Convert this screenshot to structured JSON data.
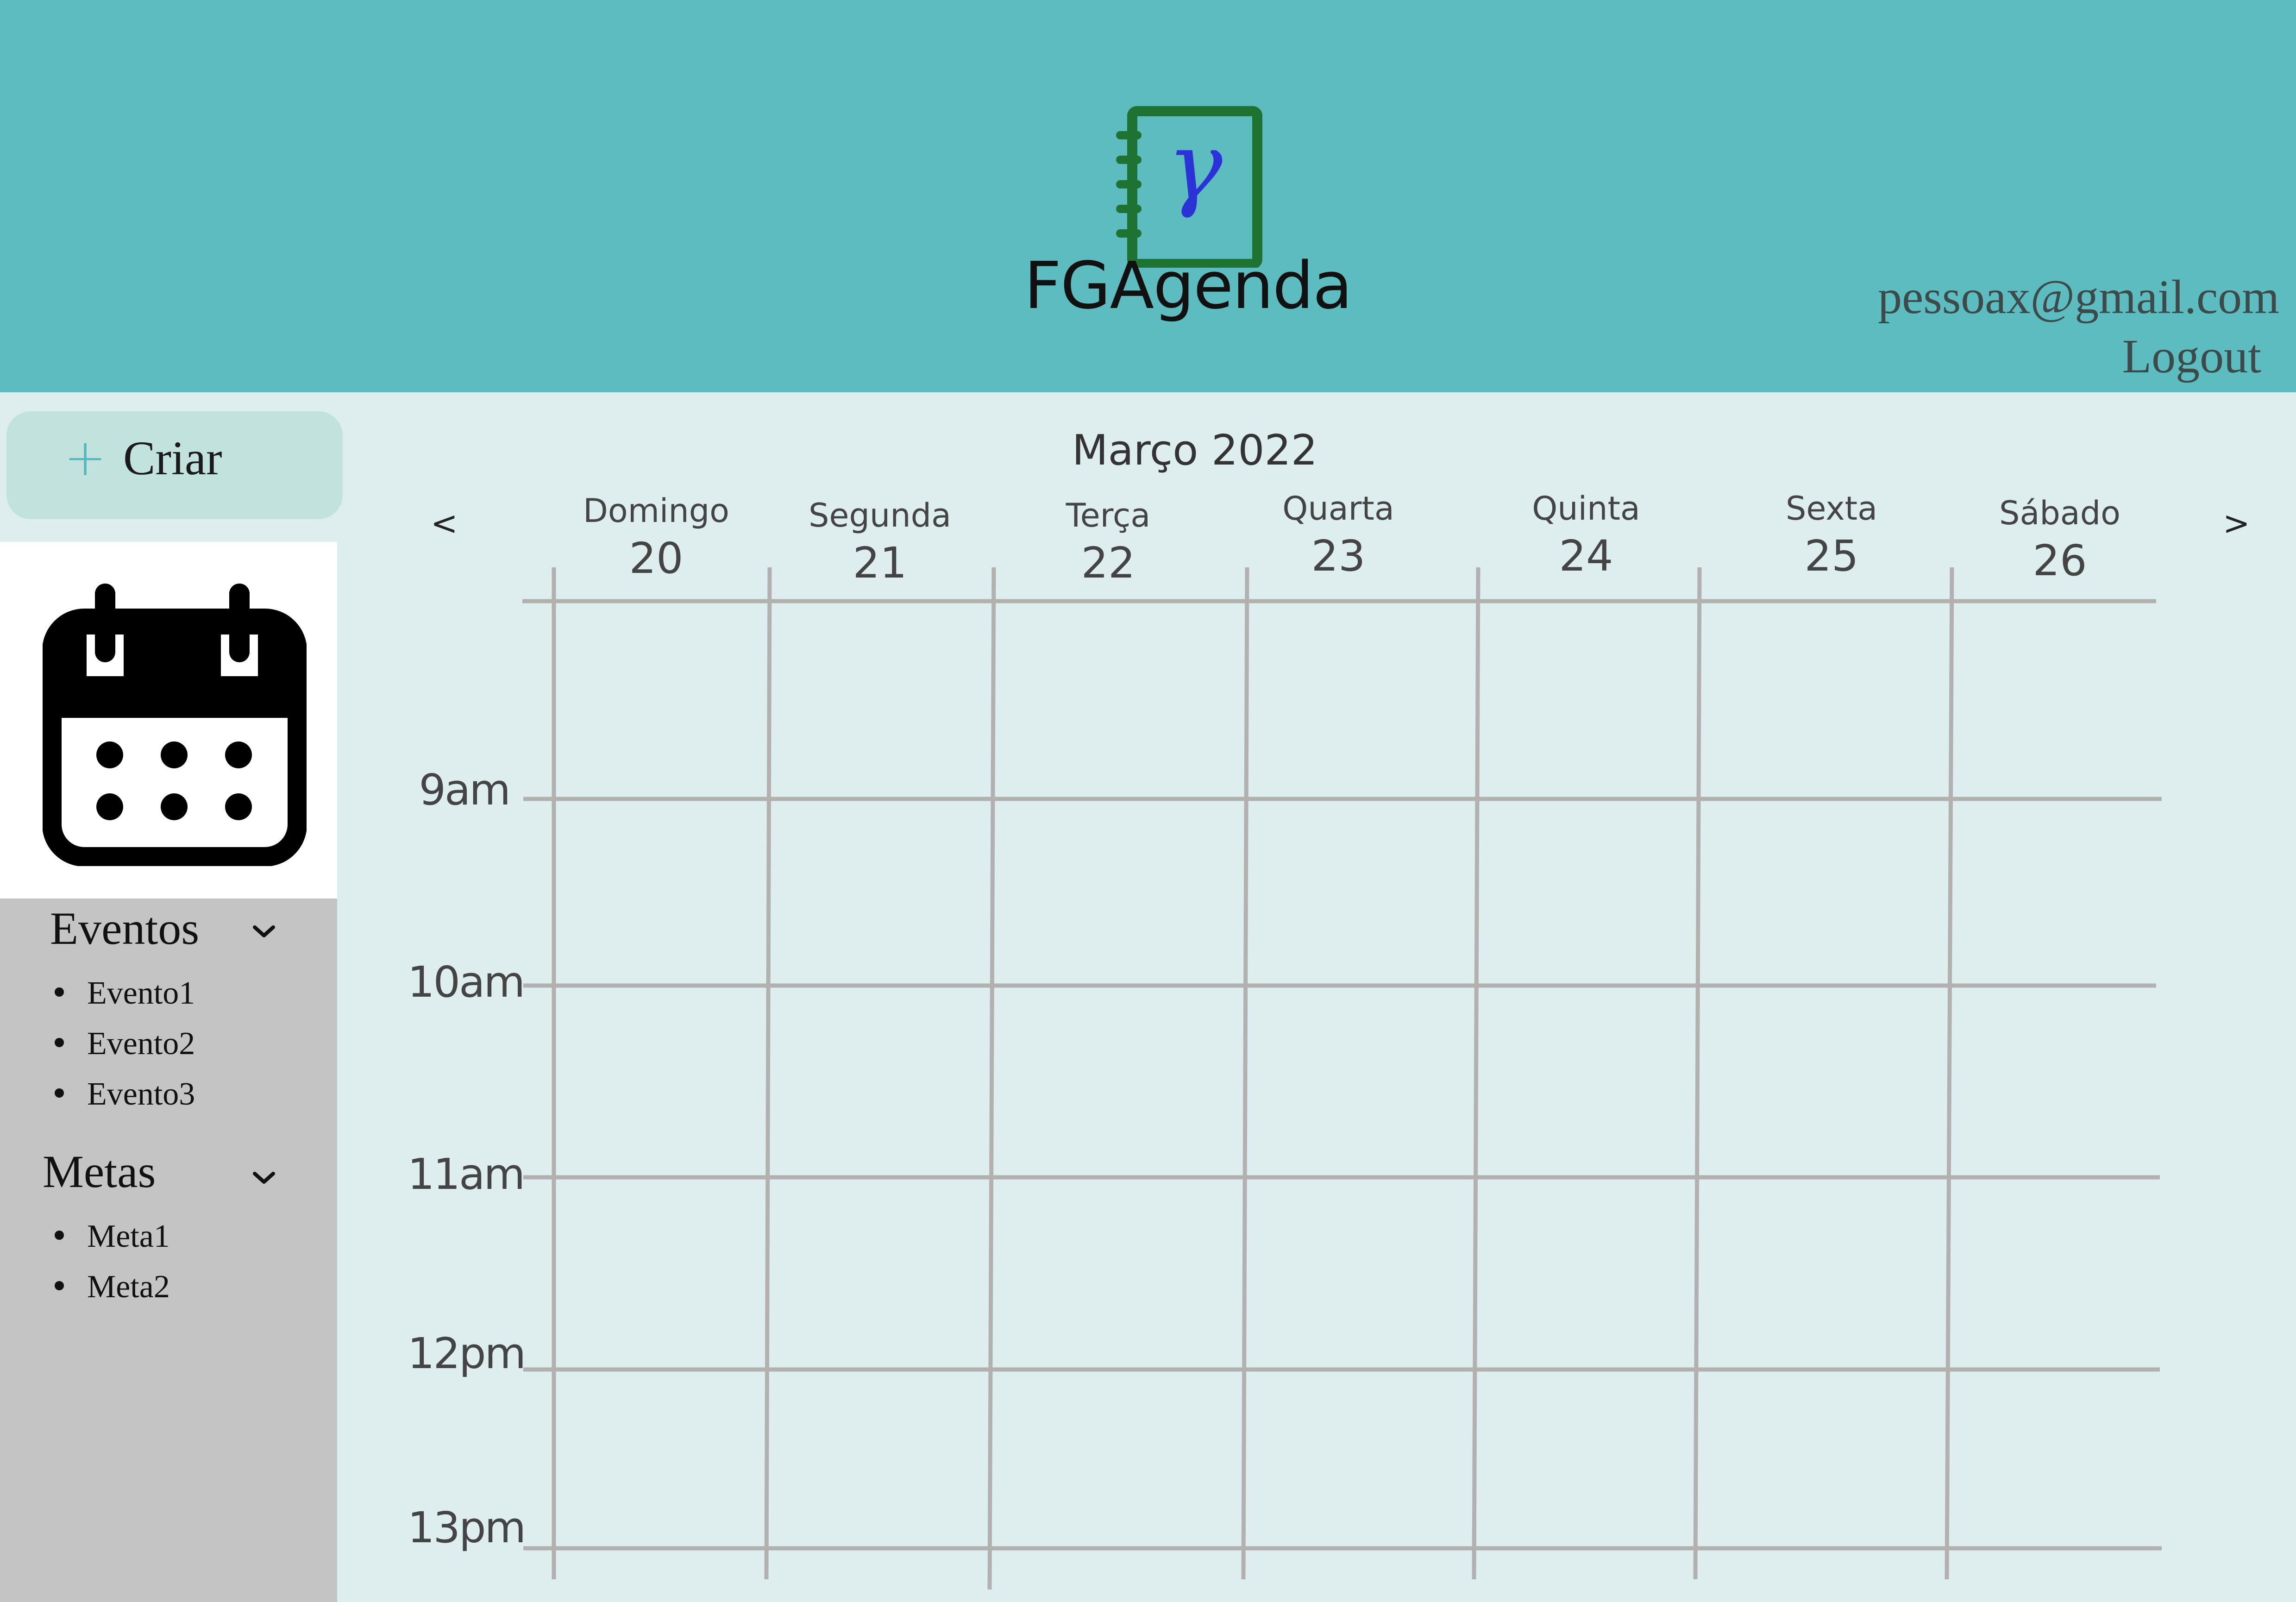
{
  "header": {
    "app_title": "FGAgenda",
    "logo_glyph": "γ",
    "logo_icon": "notebook-icon",
    "user_email": "pessoax@gmail.com",
    "logout_label": "Logout"
  },
  "sidebar": {
    "create_label": "Criar",
    "create_icon": "plus-icon",
    "calendar_icon": "calendar-icon",
    "sections": [
      {
        "title": "Eventos",
        "items": [
          "Evento1",
          "Evento2",
          "Evento3"
        ]
      },
      {
        "title": "Metas",
        "items": [
          "Meta1",
          "Meta2"
        ]
      }
    ]
  },
  "calendar": {
    "month_title": "Março 2022",
    "prev_label": "<",
    "next_label": ">",
    "days": [
      {
        "name": "Domingo",
        "date": "20"
      },
      {
        "name": "Segunda",
        "date": "21"
      },
      {
        "name": "Terça",
        "date": "22"
      },
      {
        "name": "Quarta",
        "date": "23"
      },
      {
        "name": "Quinta",
        "date": "24"
      },
      {
        "name": "Sexta",
        "date": "25"
      },
      {
        "name": "Sábado",
        "date": "26"
      }
    ],
    "times": [
      "9am",
      "10am",
      "11am",
      "12pm",
      "13pm"
    ]
  },
  "colors": {
    "header_bg": "#5cbcbf",
    "page_bg": "#deeeee",
    "sidebar_panel": "#c4c4c4",
    "create_button": "#c2e2de",
    "accent": "#52b8ba",
    "logo_green": "#1e7332",
    "logo_glyph": "#2b33d6",
    "grid_line": "#b3b0b0"
  }
}
